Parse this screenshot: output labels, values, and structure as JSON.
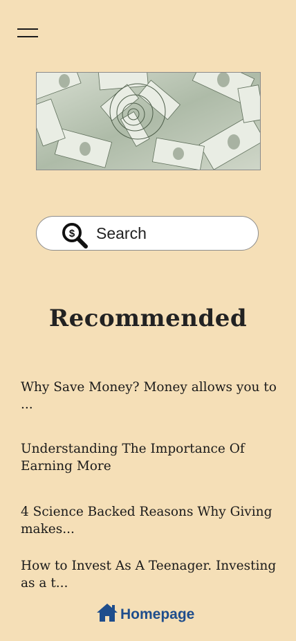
{
  "nav": {
    "menu_icon": "hamburger-icon"
  },
  "banner": {
    "image": "money-spiral-banner"
  },
  "search": {
    "label": "Search",
    "icon": "dollar-magnifier-icon"
  },
  "recommended": {
    "heading": "Recommended",
    "articles": [
      "Why Save Money? Money allows you to ...",
      "Understanding The Importance Of Earning More",
      "4 Science Backed Reasons Why Giving makes...",
      "How to Invest As A Teenager. Investing as a t..."
    ]
  },
  "footer": {
    "home_label": "Homepage",
    "home_icon": "home-icon",
    "accent": "#1e4d8c"
  },
  "colors": {
    "background": "#f5dfb7"
  }
}
